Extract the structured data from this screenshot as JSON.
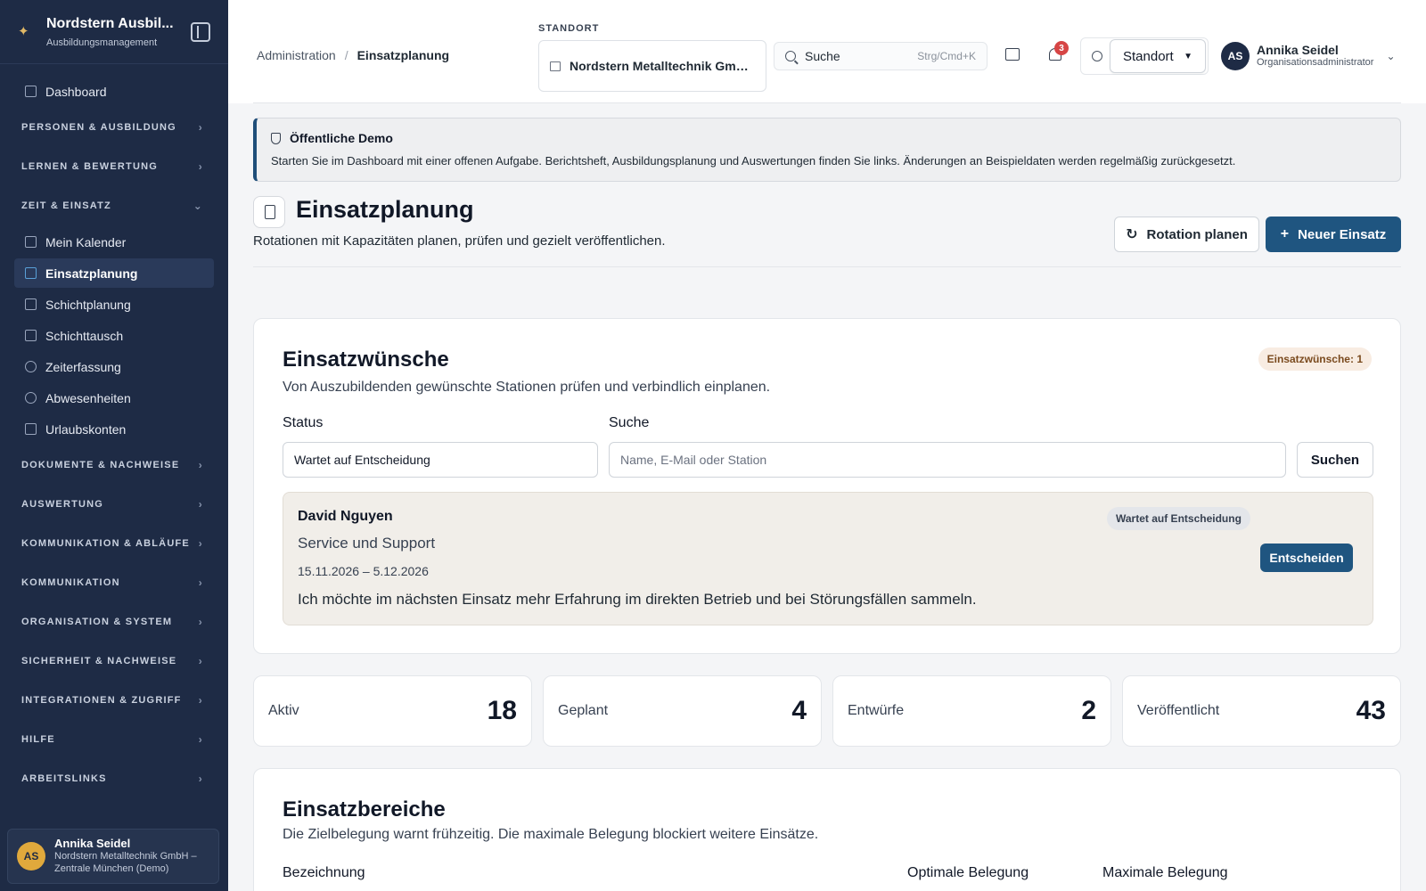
{
  "sidebar": {
    "brand_name": "Nordstern Ausbil...",
    "brand_sub": "Ausbildungsmanagement",
    "dashboard": "Dashboard",
    "groups": [
      "PERSONEN & AUSBILDUNG",
      "LERNEN & BEWERTUNG",
      "ZEIT & EINSATZ",
      "DOKUMENTE & NACHWEISE",
      "AUSWERTUNG",
      "KOMMUNIKATION & ABLÄUFE",
      "KOMMUNIKATION",
      "ORGANISATION & SYSTEM",
      "SICHERHEIT & NACHWEISE",
      "INTEGRATIONEN & ZUGRIFF",
      "HILFE",
      "ARBEITSLINKS"
    ],
    "items": [
      "Mein Kalender",
      "Einsatzplanung",
      "Schichtplanung",
      "Schichttausch",
      "Zeiterfassung",
      "Abwesenheiten",
      "Urlaubskonten"
    ],
    "user": {
      "initials": "AS",
      "name": "Annika Seidel",
      "org": "Nordstern Metalltechnik GmbH – Zentrale München (Demo)"
    }
  },
  "topbar": {
    "breadcrumb": [
      "Administration",
      "/",
      "Einsatzplanung"
    ],
    "location_label": "STANDORT",
    "location_value": "Nordstern Metalltechnik GmbH...",
    "search_label": "Suche",
    "search_shortcut": "Strg/Cmd+K",
    "notification_count": "3",
    "standort_select": "Standort",
    "user": {
      "initials": "AS",
      "name": "Annika Seidel",
      "role": "Organisationsadministrator"
    }
  },
  "demo": {
    "title": "Öffentliche Demo",
    "text": "Starten Sie im Dashboard mit einer offenen Aufgabe. Berichtsheft, Ausbildungsplanung und Auswertungen finden Sie links. Änderungen an Beispieldaten werden regelmäßig zurückgesetzt."
  },
  "page": {
    "title": "Einsatzplanung",
    "subtitle": "Rotationen mit Kapazitäten planen, prüfen und gezielt veröffentlichen.",
    "rotation_button": "Rotation planen",
    "new_button": "Neuer Einsatz"
  },
  "wishes": {
    "title": "Einsatzwünsche",
    "subtitle": "Von Auszubildenden gewünschte Stationen prüfen und verbindlich einplanen.",
    "count_badge": "Einsatzwünsche: 1",
    "status_label": "Status",
    "status_value": "Wartet auf Entscheidung",
    "search_label": "Suche",
    "search_placeholder": "Name, E-Mail oder Station",
    "search_button": "Suchen",
    "request": {
      "name": "David Nguyen",
      "station": "Service und Support",
      "dates": "15.11.2026 – 5.12.2026",
      "text": "Ich möchte im nächsten Einsatz mehr Erfahrung im direkten Betrieb und bei Störungsfällen sammeln.",
      "status": "Wartet auf Entscheidung",
      "decide_button": "Entscheiden"
    }
  },
  "stats": [
    {
      "label": "Aktiv",
      "value": "18"
    },
    {
      "label": "Geplant",
      "value": "4"
    },
    {
      "label": "Entwürfe",
      "value": "2"
    },
    {
      "label": "Veröffentlicht",
      "value": "43"
    }
  ],
  "areas": {
    "title": "Einsatzbereiche",
    "subtitle": "Die Zielbelegung warnt frühzeitig. Die maximale Belegung blockiert weitere Einsätze.",
    "col_name": "Bezeichnung",
    "col_optimal": "Optimale Belegung",
    "col_max": "Maximale Belegung"
  }
}
